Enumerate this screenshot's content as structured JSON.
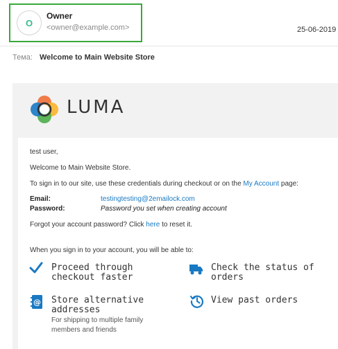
{
  "sender": {
    "avatar_initial": "O",
    "name": "Owner",
    "email": "<owner@example.com>"
  },
  "date": "25-06-2019",
  "subject": {
    "label": "Тема:",
    "value": "Welcome to Main Website Store"
  },
  "brand": {
    "name": "LUMA"
  },
  "body": {
    "greeting": "test user,",
    "welcome": "Welcome to Main Website Store.",
    "signin_prefix": "To sign in to our site, use these credentials during checkout or on the ",
    "my_account_link": "My Account",
    "signin_suffix": " page:",
    "email_label": "Email:",
    "email_value": "testingtesting@2emailock.com",
    "password_label": "Password:",
    "password_value": "Password you set when creating account",
    "forgot_prefix": "Forgot your account password? Click ",
    "forgot_link": "here",
    "forgot_suffix": " to reset it.",
    "able_to": "When you sign in to your account, you will be able to:"
  },
  "features": [
    {
      "icon": "checkmark-icon",
      "title": "Proceed through\ncheckout faster",
      "subtitle": ""
    },
    {
      "icon": "truck-icon",
      "title": "Check the status of\norders",
      "subtitle": ""
    },
    {
      "icon": "address-book-icon",
      "title": "Store alternative\naddresses",
      "subtitle": "For shipping to multiple family members and friends"
    },
    {
      "icon": "history-icon",
      "title": "View past orders",
      "subtitle": ""
    }
  ],
  "colors": {
    "highlight_border": "#39a83a",
    "link": "#1979c3",
    "icon_blue": "#1979c3"
  }
}
